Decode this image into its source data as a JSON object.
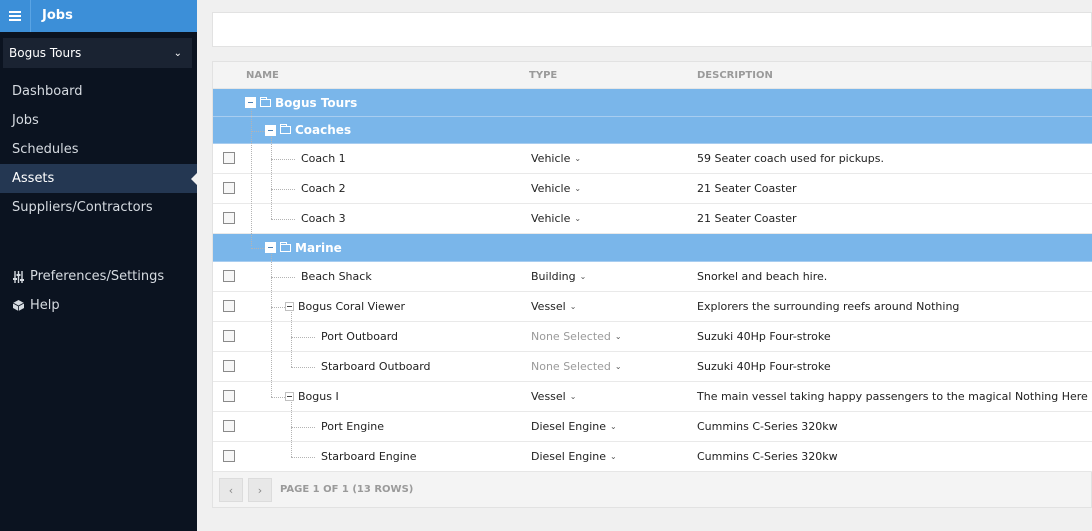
{
  "app": {
    "title": "Jobs",
    "organization": "Bogus Tours"
  },
  "nav": {
    "items": [
      "Dashboard",
      "Jobs",
      "Schedules",
      "Assets",
      "Suppliers/Contractors"
    ],
    "preferences": "Preferences/Settings",
    "help": "Help"
  },
  "grid": {
    "columns": {
      "name": "NAME",
      "type": "TYPE",
      "description": "DESCRIPTION"
    },
    "groups": {
      "root": "Bogus Tours",
      "coaches": "Coaches",
      "marine": "Marine"
    },
    "rows": [
      {
        "name": "Coach 1",
        "type": "Vehicle",
        "description": "59 Seater coach used for pickups."
      },
      {
        "name": "Coach 2",
        "type": "Vehicle",
        "description": "21 Seater Coaster"
      },
      {
        "name": "Coach 3",
        "type": "Vehicle",
        "description": "21 Seater Coaster"
      },
      {
        "name": "Beach Shack",
        "type": "Building",
        "description": "Snorkel and beach hire."
      },
      {
        "name": "Bogus Coral Viewer",
        "type": "Vessel",
        "description": "Explorers the surrounding reefs around Nothing"
      },
      {
        "name": "Port Outboard",
        "type": "None Selected",
        "description": "Suzuki 40Hp Four-stroke"
      },
      {
        "name": "Starboard Outboard",
        "type": "None Selected",
        "description": "Suzuki 40Hp Four-stroke"
      },
      {
        "name": "Bogus I",
        "type": "Vessel",
        "description": "The main vessel taking happy passengers to the magical Nothing Here Island."
      },
      {
        "name": "Port Engine",
        "type": "Diesel Engine",
        "description": "Cummins C-Series 320kw"
      },
      {
        "name": "Starboard Engine",
        "type": "Diesel Engine",
        "description": "Cummins C-Series 320kw"
      }
    ],
    "pager": {
      "prev": "‹",
      "next": "›",
      "info": "PAGE 1 OF 1 (13 ROWS)"
    }
  },
  "colors": {
    "header_blue": "#3c8fd8",
    "group_row": "#7ab6ea",
    "sidebar_bg": "#0b1320",
    "active_nav": "#243752"
  },
  "icons": {
    "menu": "hamburger-icon",
    "dropdown": "chevron-down-icon",
    "prefs": "sliders-icon",
    "help": "box-icon",
    "folder": "folder-icon",
    "collapse": "minus-icon"
  }
}
